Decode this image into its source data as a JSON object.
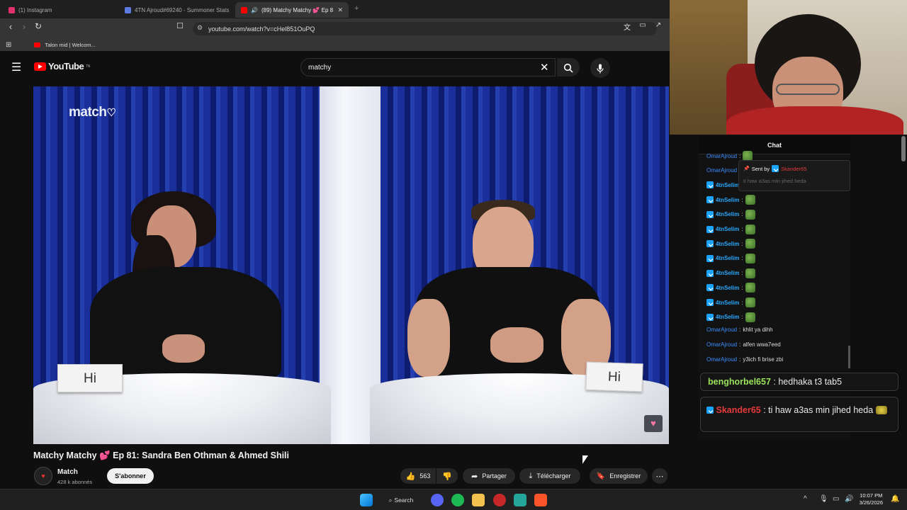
{
  "browser": {
    "tabs": [
      {
        "label": "(1) Instagram",
        "favicon_color": "#e1306c"
      },
      {
        "label": "4TN Ajroud#69240 - Summoner Stats",
        "favicon_color": "#5b7be0"
      },
      {
        "label": "(89) Matchy Matchy 💕 Ep 8",
        "favicon_color": "#ff0000",
        "active": true
      }
    ],
    "url": "youtube.com/watch?v=cHel851OuPQ",
    "bookmark": "Talon mid | Welcom..."
  },
  "youtube": {
    "logo": "YouTube",
    "logo_sup": "TN",
    "search_value": "matchy"
  },
  "video": {
    "watermark": "match",
    "card_left": "Hi",
    "card_right": "Hi",
    "title": "Matchy Matchy 💕 Ep 81: Sandra Ben Othman & Ahmed Shili"
  },
  "channel": {
    "name": "Match",
    "subscribers": "428 k abonnés",
    "subscribe_label": "S'abonner"
  },
  "actions": {
    "likes": "563",
    "share": "Partager",
    "download": "Télécharger",
    "save": "Enregistrer"
  },
  "chat": {
    "header": "Chat",
    "pinned_by": "Sent by",
    "pinned_user": "Skander65",
    "pinned_text": "ti haw a3as min jihed heda",
    "messages": [
      {
        "user": "OmarAjroud",
        "text": ""
      },
      {
        "user": "OmarAjroud",
        "text": ""
      },
      {
        "user": "4tnSelim",
        "text": ""
      },
      {
        "user": "4tnSelim",
        "text": ""
      },
      {
        "user": "4tnSelim",
        "text": ""
      },
      {
        "user": "4tnSelim",
        "text": ""
      },
      {
        "user": "4tnSelim",
        "text": ""
      },
      {
        "user": "4tnSelim",
        "text": ""
      },
      {
        "user": "4tnSelim",
        "text": ""
      },
      {
        "user": "4tnSelim",
        "text": ""
      },
      {
        "user": "4tnSelim",
        "text": ""
      },
      {
        "user": "4tnSelim",
        "text": ""
      },
      {
        "user": "OmarAjroud",
        "text": "khlit ya dihh"
      },
      {
        "user": "OmarAjroud",
        "text": "alfen wwa7eed"
      },
      {
        "user": "OmarAjroud",
        "text": "y3ich fi brise zbi"
      }
    ],
    "overlay": [
      {
        "user": "benghorbel657",
        "text": "hedhaka t3 tab5"
      },
      {
        "user": "Skander65",
        "text": "ti haw a3as min jihed heda"
      }
    ]
  },
  "taskbar": {
    "search": "Search",
    "time": "10:07 PM",
    "date": "3/26/2026"
  }
}
